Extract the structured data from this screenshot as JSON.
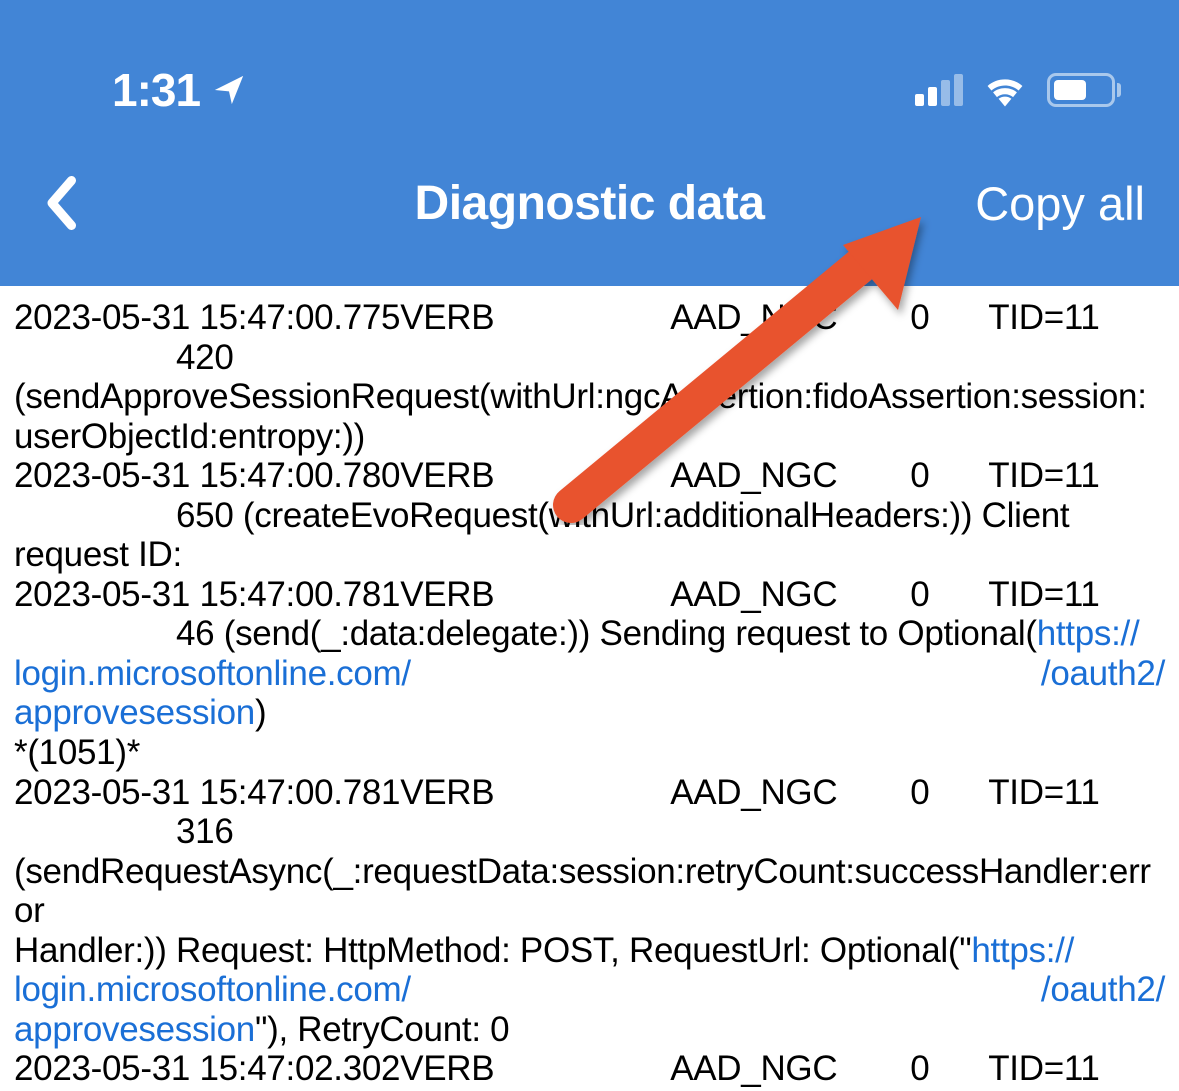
{
  "statusBar": {
    "time": "1:31"
  },
  "nav": {
    "title": "Diagnostic data",
    "copyAll": "Copy all"
  },
  "entries": [
    {
      "ts": "2023-05-31 15:47:00.775",
      "level": "VERB",
      "tag": "AAD_NGC",
      "zero": "0",
      "tid": "TID=11",
      "codeLinePrefix": "420",
      "msgBefore": "(sendApproveSessionRequest(withUrl:ngcAssertion:fidoAssertion:session:userObjectId:entropy:))"
    },
    {
      "ts": "2023-05-31 15:47:00.780",
      "level": "VERB",
      "tag": "AAD_NGC",
      "zero": "0",
      "tid": "TID=11",
      "indentMsg": "650 (createEvoRequest(withUrl:additionalHeaders:)) Client",
      "cont": "request ID:"
    },
    {
      "ts": "2023-05-31 15:47:00.781",
      "level": "VERB",
      "tag": "AAD_NGC",
      "zero": "0",
      "tid": "TID=11",
      "indentMsg": "46 (send(_:data:delegate:)) Sending request to Optional(",
      "link1": "https://",
      "linkStart": "login.microsoftonline.com/",
      "linkRight": "/oauth2/",
      "linkEnd": "approvesession",
      "after": ")",
      "extra": "*(1051)*"
    },
    {
      "ts": "2023-05-31 15:47:00.781",
      "level": "VERB",
      "tag": "AAD_NGC",
      "zero": "0",
      "tid": "TID=11",
      "codeLinePrefix": "316",
      "msg1": "(sendRequestAsync(_:requestData:session:retryCount:successHandler:error",
      "msg2a": "Handler:)) Request: HttpMethod: POST, RequestUrl: Optional(\"",
      "link1": "https://",
      "linkStart": "login.microsoftonline.com/",
      "linkRight": "/oauth2/",
      "linkEnd": "approvesession",
      "msg2b": "\"), RetryCount: 0"
    },
    {
      "ts": "2023-05-31 15:47:02.302",
      "level": "VERB",
      "tag": "AAD_NGC",
      "zero": "0",
      "tid": "TID=11"
    }
  ]
}
